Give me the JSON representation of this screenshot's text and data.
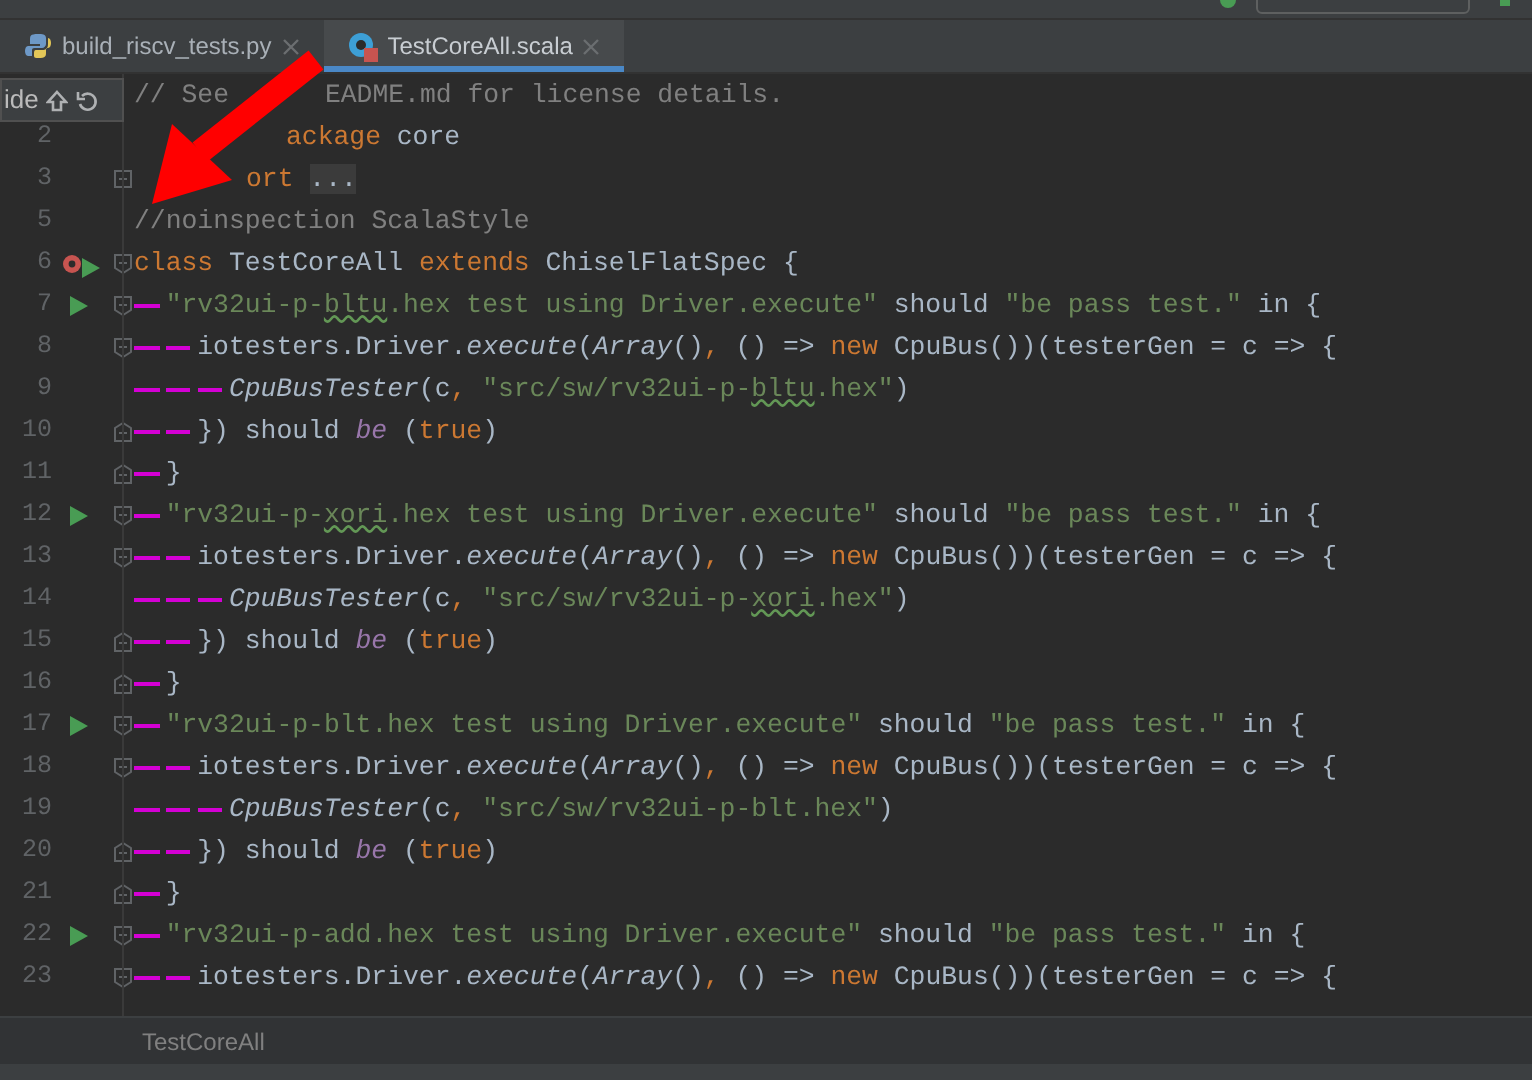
{
  "tabs": [
    {
      "label": "build_riscv_tests.py",
      "kind": "python",
      "selected": false
    },
    {
      "label": "TestCoreAll.scala",
      "kind": "scala",
      "selected": true
    }
  ],
  "hide_popup": {
    "label": "ide"
  },
  "lines": [
    {
      "runnable": false,
      "test_class": false,
      "fold_start": false,
      "fold_end": false,
      "folded": false,
      "tokens": [
        {
          "kind": "comment",
          "t": "// See"
        },
        {
          "kind": "comment",
          "t": "EADME.md for license details."
        }
      ]
    },
    {
      "number": "2",
      "runnable": false,
      "test_class": false,
      "fold_start": false,
      "fold_end": false,
      "folded": false,
      "tokens": [
        {
          "kind": "keyword",
          "t": "ackage"
        },
        {
          "kind": "plain",
          "t": " core"
        }
      ]
    },
    {
      "number": "3",
      "runnable": false,
      "test_class": false,
      "fold_start": false,
      "fold_end": false,
      "folded": true,
      "tokens": [
        {
          "kind": "keyword",
          "t": "ort"
        },
        {
          "kind": "folded",
          "t": "..."
        }
      ]
    },
    {
      "number": "5",
      "runnable": false,
      "test_class": false,
      "fold_start": false,
      "fold_end": false,
      "folded": false,
      "tokens": [
        {
          "kind": "comment",
          "t": "//noinspection ScalaStyle"
        }
      ]
    },
    {
      "number": "6",
      "runnable": true,
      "test_class": true,
      "fold_start": true,
      "fold_end": false,
      "folded": false,
      "tokens": [
        {
          "kind": "keyword",
          "t": "class "
        },
        {
          "kind": "plain",
          "t": "TestCoreAll "
        },
        {
          "kind": "keyword",
          "t": "extends "
        },
        {
          "kind": "plain",
          "t": "ChiselFlatSpec {"
        }
      ],
      "children": [
        {
          "number": "7",
          "runnable": true,
          "test_class": false,
          "fold_start": true,
          "fold_end": false,
          "folded": false,
          "tokens": [
            {
              "kind": "string",
              "t": "\"rv32ui-p-"
            },
            {
              "kind": "typo",
              "t": "bltu"
            },
            {
              "kind": "string",
              "t": ".hex test using Driver.execute\""
            },
            {
              "kind": "plain",
              "t": " should "
            },
            {
              "kind": "string",
              "t": "\"be pass test.\""
            },
            {
              "kind": "plain",
              "t": " in {"
            }
          ],
          "children": [
            {
              "number": "8",
              "runnable": false,
              "test_class": false,
              "fold_start": true,
              "fold_end": false,
              "folded": false,
              "tokens": [
                {
                  "kind": "plain",
                  "t": "iotesters.Driver."
                },
                {
                  "kind": "italic",
                  "t": "execute"
                },
                {
                  "kind": "plain",
                  "t": "("
                },
                {
                  "kind": "italic",
                  "t": "Array"
                },
                {
                  "kind": "plain",
                  "t": "()"
                },
                {
                  "kind": "keyword",
                  "t": ","
                },
                {
                  "kind": "plain",
                  "t": " () => "
                },
                {
                  "kind": "keyword",
                  "t": "new"
                },
                {
                  "kind": "plain",
                  "t": " CpuBus())(testerGen = c => {"
                }
              ],
              "children": [
                {
                  "number": "9",
                  "runnable": false,
                  "test_class": false,
                  "fold_start": false,
                  "fold_end": false,
                  "folded": false,
                  "tokens": [
                    {
                      "kind": "italic",
                      "t": "CpuBusTester"
                    },
                    {
                      "kind": "plain",
                      "t": "(c"
                    },
                    {
                      "kind": "keyword",
                      "t": ","
                    },
                    {
                      "kind": "string",
                      "t": " \"src/sw/rv32ui-p-"
                    },
                    {
                      "kind": "typo",
                      "t": "bltu"
                    },
                    {
                      "kind": "string",
                      "t": ".hex\""
                    },
                    {
                      "kind": "plain",
                      "t": ")"
                    }
                  ]
                }
              ]
            },
            {
              "number": "10",
              "runnable": false,
              "test_class": false,
              "fold_start": false,
              "fold_end": true,
              "folded": false,
              "tokens": [
                {
                  "kind": "plain",
                  "t": "}) should "
                },
                {
                  "kind": "member",
                  "t": "be"
                },
                {
                  "kind": "plain",
                  "t": " ("
                },
                {
                  "kind": "keyword",
                  "t": "true"
                },
                {
                  "kind": "plain",
                  "t": ")"
                }
              ]
            }
          ]
        },
        {
          "number": "11",
          "runnable": false,
          "test_class": false,
          "fold_start": false,
          "fold_end": true,
          "folded": false,
          "tokens": [
            {
              "kind": "plain",
              "t": "}"
            }
          ]
        },
        {
          "number": "12",
          "runnable": true,
          "test_class": false,
          "fold_start": true,
          "fold_end": false,
          "folded": false,
          "tokens": [
            {
              "kind": "string",
              "t": "\"rv32ui-p-"
            },
            {
              "kind": "typo",
              "t": "xori"
            },
            {
              "kind": "string",
              "t": ".hex test using Driver.execute\""
            },
            {
              "kind": "plain",
              "t": " should "
            },
            {
              "kind": "string",
              "t": "\"be pass test.\""
            },
            {
              "kind": "plain",
              "t": " in {"
            }
          ],
          "children": [
            {
              "number": "13",
              "runnable": false,
              "test_class": false,
              "fold_start": true,
              "fold_end": false,
              "folded": false,
              "tokens": [
                {
                  "kind": "plain",
                  "t": "iotesters.Driver."
                },
                {
                  "kind": "italic",
                  "t": "execute"
                },
                {
                  "kind": "plain",
                  "t": "("
                },
                {
                  "kind": "italic",
                  "t": "Array"
                },
                {
                  "kind": "plain",
                  "t": "()"
                },
                {
                  "kind": "keyword",
                  "t": ","
                },
                {
                  "kind": "plain",
                  "t": " () => "
                },
                {
                  "kind": "keyword",
                  "t": "new"
                },
                {
                  "kind": "plain",
                  "t": " CpuBus())(testerGen = c => {"
                }
              ],
              "children": [
                {
                  "number": "14",
                  "runnable": false,
                  "test_class": false,
                  "fold_start": false,
                  "fold_end": false,
                  "folded": false,
                  "tokens": [
                    {
                      "kind": "italic",
                      "t": "CpuBusTester"
                    },
                    {
                      "kind": "plain",
                      "t": "(c"
                    },
                    {
                      "kind": "keyword",
                      "t": ","
                    },
                    {
                      "kind": "string",
                      "t": " \"src/sw/rv32ui-p-"
                    },
                    {
                      "kind": "typo",
                      "t": "xori"
                    },
                    {
                      "kind": "string",
                      "t": ".hex\""
                    },
                    {
                      "kind": "plain",
                      "t": ")"
                    }
                  ]
                }
              ]
            },
            {
              "number": "15",
              "runnable": false,
              "test_class": false,
              "fold_start": false,
              "fold_end": true,
              "folded": false,
              "tokens": [
                {
                  "kind": "plain",
                  "t": "}) should "
                },
                {
                  "kind": "member",
                  "t": "be"
                },
                {
                  "kind": "plain",
                  "t": " ("
                },
                {
                  "kind": "keyword",
                  "t": "true"
                },
                {
                  "kind": "plain",
                  "t": ")"
                }
              ]
            }
          ]
        },
        {
          "number": "16",
          "runnable": false,
          "test_class": false,
          "fold_start": false,
          "fold_end": true,
          "folded": false,
          "tokens": [
            {
              "kind": "plain",
              "t": "}"
            }
          ]
        },
        {
          "number": "17",
          "runnable": true,
          "test_class": false,
          "fold_start": true,
          "fold_end": false,
          "folded": false,
          "tokens": [
            {
              "kind": "string",
              "t": "\"rv32ui-p-blt.hex test using Driver.execute\""
            },
            {
              "kind": "plain",
              "t": " should "
            },
            {
              "kind": "string",
              "t": "\"be pass test.\""
            },
            {
              "kind": "plain",
              "t": " in {"
            }
          ],
          "children": [
            {
              "number": "18",
              "runnable": false,
              "test_class": false,
              "fold_start": true,
              "fold_end": false,
              "folded": false,
              "tokens": [
                {
                  "kind": "plain",
                  "t": "iotesters.Driver."
                },
                {
                  "kind": "italic",
                  "t": "execute"
                },
                {
                  "kind": "plain",
                  "t": "("
                },
                {
                  "kind": "italic",
                  "t": "Array"
                },
                {
                  "kind": "plain",
                  "t": "()"
                },
                {
                  "kind": "keyword",
                  "t": ","
                },
                {
                  "kind": "plain",
                  "t": " () => "
                },
                {
                  "kind": "keyword",
                  "t": "new"
                },
                {
                  "kind": "plain",
                  "t": " CpuBus())(testerGen = c => {"
                }
              ],
              "children": [
                {
                  "number": "19",
                  "runnable": false,
                  "test_class": false,
                  "fold_start": false,
                  "fold_end": false,
                  "folded": false,
                  "tokens": [
                    {
                      "kind": "italic",
                      "t": "CpuBusTester"
                    },
                    {
                      "kind": "plain",
                      "t": "(c"
                    },
                    {
                      "kind": "keyword",
                      "t": ","
                    },
                    {
                      "kind": "string",
                      "t": " \"src/sw/rv32ui-p-blt.hex\""
                    },
                    {
                      "kind": "plain",
                      "t": ")"
                    }
                  ]
                }
              ]
            },
            {
              "number": "20",
              "runnable": false,
              "test_class": false,
              "fold_start": false,
              "fold_end": true,
              "folded": false,
              "tokens": [
                {
                  "kind": "plain",
                  "t": "}) should "
                },
                {
                  "kind": "member",
                  "t": "be"
                },
                {
                  "kind": "plain",
                  "t": " ("
                },
                {
                  "kind": "keyword",
                  "t": "true"
                },
                {
                  "kind": "plain",
                  "t": ")"
                }
              ]
            }
          ]
        },
        {
          "number": "21",
          "runnable": false,
          "test_class": false,
          "fold_start": false,
          "fold_end": true,
          "folded": false,
          "tokens": [
            {
              "kind": "plain",
              "t": "}"
            }
          ]
        },
        {
          "number": "22",
          "runnable": true,
          "test_class": false,
          "fold_start": true,
          "fold_end": false,
          "folded": false,
          "tokens": [
            {
              "kind": "string",
              "t": "\"rv32ui-p-add.hex test using Driver.execute\""
            },
            {
              "kind": "plain",
              "t": " should "
            },
            {
              "kind": "string",
              "t": "\"be pass test.\""
            },
            {
              "kind": "plain",
              "t": " in {"
            }
          ],
          "children": [
            {
              "number": "23",
              "runnable": false,
              "test_class": false,
              "fold_start": true,
              "fold_end": false,
              "folded": false,
              "tokens": [
                {
                  "kind": "plain",
                  "t": "iotesters.Driver."
                },
                {
                  "kind": "italic",
                  "t": "execute"
                },
                {
                  "kind": "plain",
                  "t": "("
                },
                {
                  "kind": "italic",
                  "t": "Array"
                },
                {
                  "kind": "plain",
                  "t": "()"
                },
                {
                  "kind": "keyword",
                  "t": ","
                },
                {
                  "kind": "plain",
                  "t": " () => "
                },
                {
                  "kind": "keyword",
                  "t": "new"
                },
                {
                  "kind": "plain",
                  "t": " CpuBus())(testerGen = c => {"
                }
              ]
            }
          ]
        }
      ]
    }
  ],
  "breadcrumb": "TestCoreAll"
}
